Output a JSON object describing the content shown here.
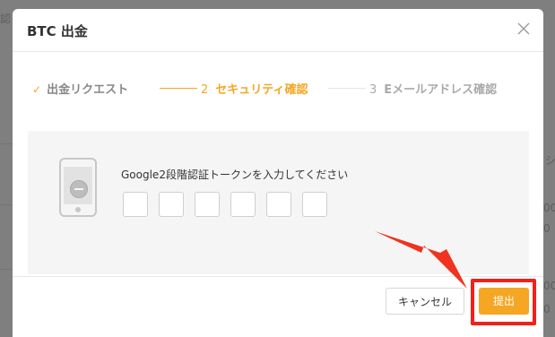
{
  "modal": {
    "title": "BTC 出金",
    "close_icon": "close-icon"
  },
  "steps": [
    {
      "index": "✓",
      "label": "出金リクエスト",
      "state": "done"
    },
    {
      "index": "2",
      "label": "セキュリティ確認",
      "state": "active"
    },
    {
      "index": "3",
      "label": "Eメールアドレス確認",
      "state": "pending"
    }
  ],
  "security": {
    "phone_icon": "phone-authenticator-icon",
    "label": "Google2段階認証トークンを入力してください",
    "digit_count": 6
  },
  "footer": {
    "cancel_label": "キャンセル",
    "submit_label": "提出"
  },
  "annotation": {
    "arrow_icon": "pointer-arrow-icon",
    "highlight_color": "#f2201b"
  },
  "colors": {
    "accent": "#f5a623",
    "overlay": "#7f7f7f"
  },
  "background_page": {
    "fragments": [
      "認",
      "シ",
      "00",
      "0",
      "00",
      "0"
    ]
  }
}
